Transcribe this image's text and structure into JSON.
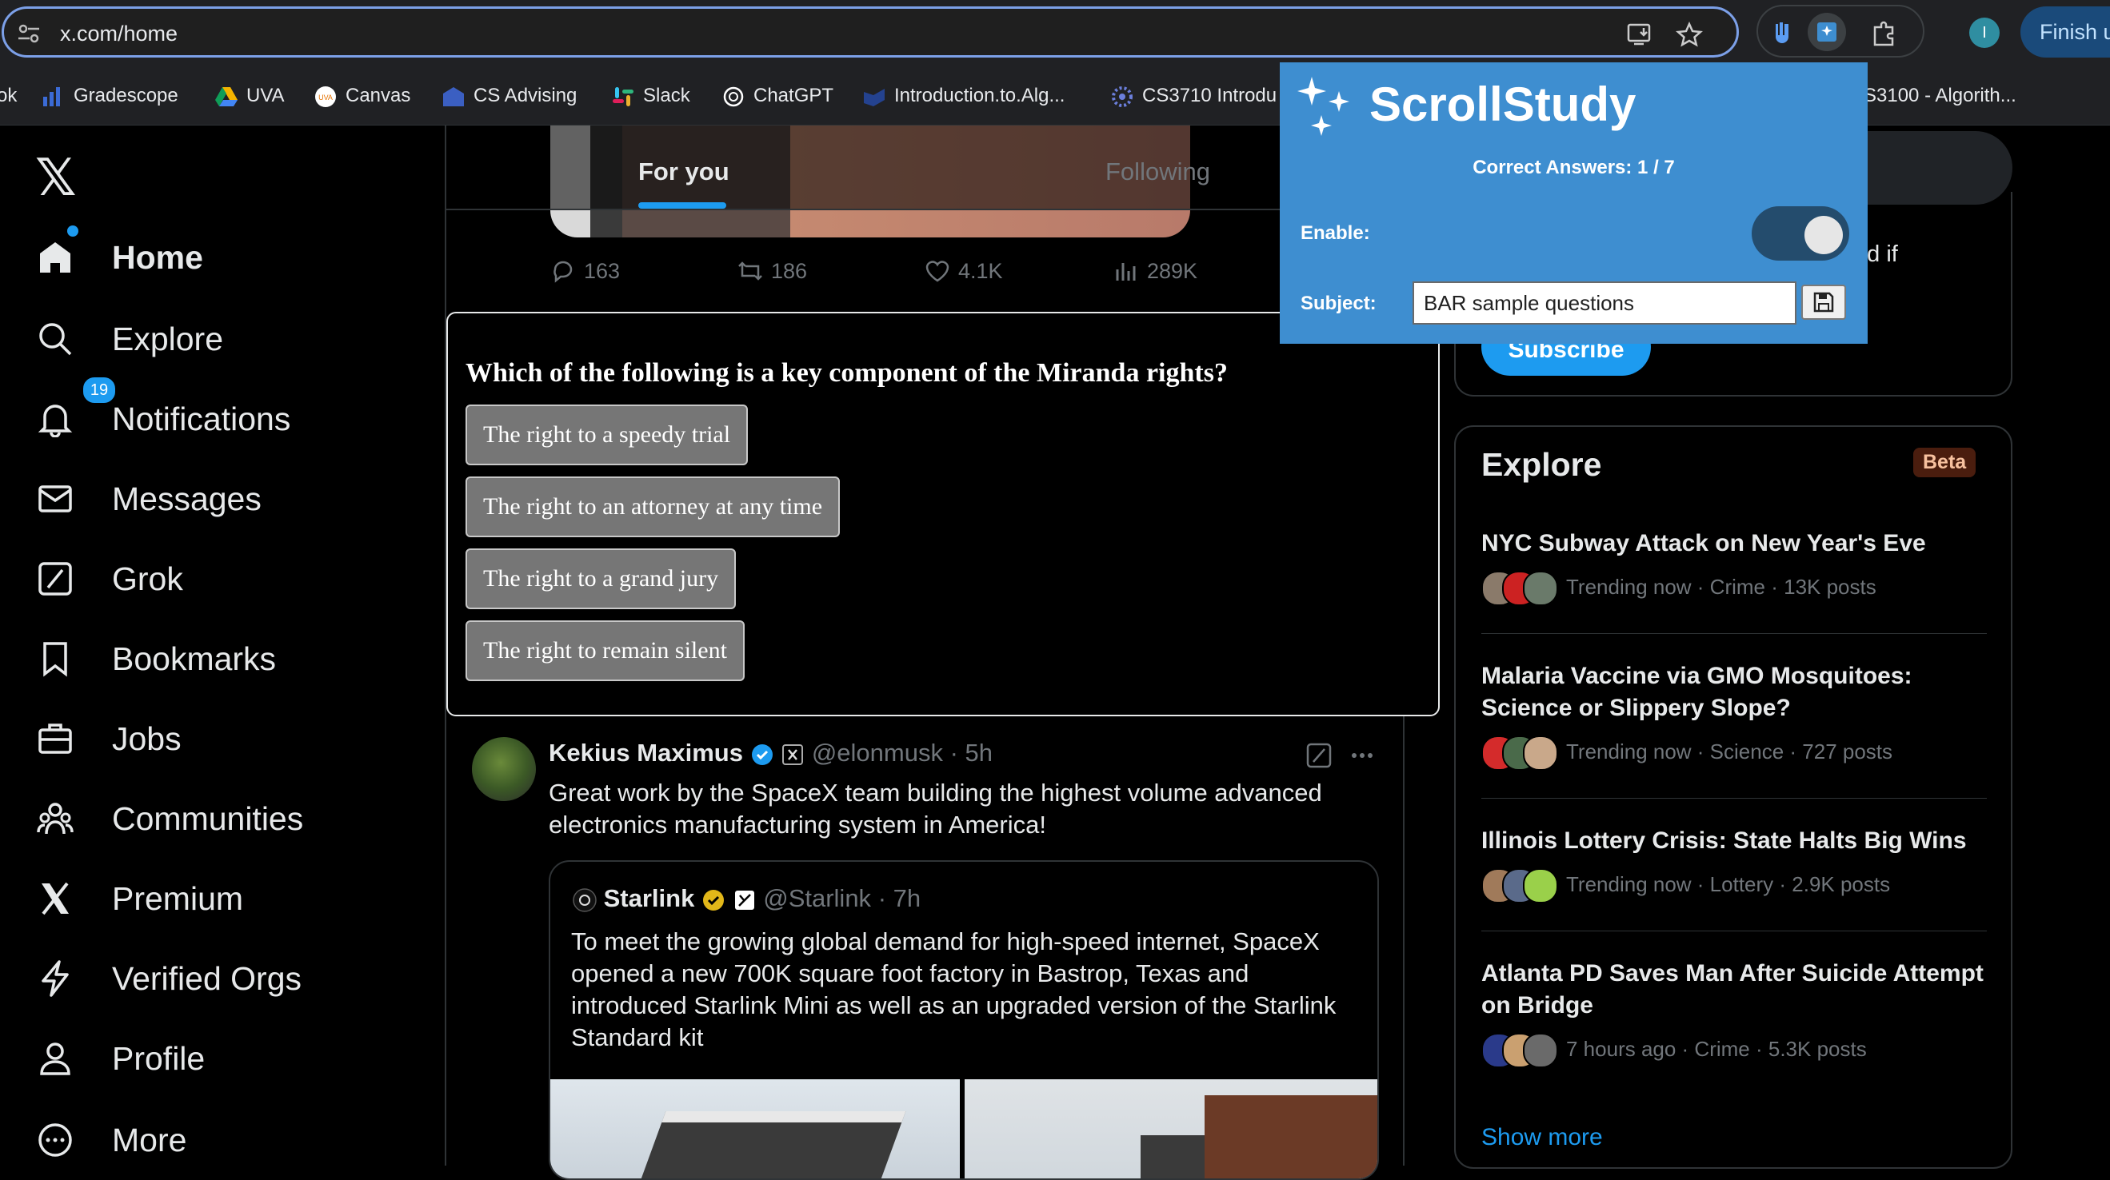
{
  "browser": {
    "url": "x.com/home",
    "profile_initial": "I",
    "finish_label": "Finish u"
  },
  "bookmarks": [
    {
      "label": "ok"
    },
    {
      "label": "Gradescope"
    },
    {
      "label": "UVA"
    },
    {
      "label": "Canvas"
    },
    {
      "label": "CS Advising"
    },
    {
      "label": "Slack"
    },
    {
      "label": "ChatGPT"
    },
    {
      "label": "Introduction.to.Alg..."
    },
    {
      "label": "CS3710 Introdu"
    },
    {
      "label": "S3100 - Algorith..."
    }
  ],
  "nav": {
    "items": [
      {
        "label": "Home"
      },
      {
        "label": "Explore"
      },
      {
        "label": "Notifications",
        "badge": "19"
      },
      {
        "label": "Messages"
      },
      {
        "label": "Grok"
      },
      {
        "label": "Bookmarks"
      },
      {
        "label": "Jobs"
      },
      {
        "label": "Communities"
      },
      {
        "label": "Premium"
      },
      {
        "label": "Verified Orgs"
      },
      {
        "label": "Profile"
      },
      {
        "label": "More"
      }
    ]
  },
  "feed": {
    "tabs": [
      {
        "label": "For you"
      },
      {
        "label": "Following"
      }
    ],
    "prev_tweet_actions": {
      "replies": "163",
      "reposts": "186",
      "likes": "4.1K",
      "views": "289K"
    },
    "quiz": {
      "question": "Which of the following is a key component of the Miranda rights?",
      "options": [
        "The right to a speedy trial",
        "The right to an attorney at any time",
        "The right to a grand jury",
        "The right to remain silent"
      ]
    },
    "tweet": {
      "author": "Kekius Maximus",
      "handle": "@elonmusk",
      "time": "· 5h",
      "text": "Great work by the SpaceX team building the highest volume advanced electronics manufacturing system in America!",
      "quote": {
        "author": "Starlink",
        "handle": "@Starlink",
        "time": "· 7h",
        "text": "To meet the growing global demand for high-speed internet, SpaceX opened a new 700K square foot factory in Bastrop, Texas and introduced Starlink Mini as well as an upgraded version of the Starlink Standard kit"
      }
    }
  },
  "sidebar": {
    "subscribe_text": "nd if",
    "subscribe_label": "Subscribe",
    "explore": {
      "title": "Explore",
      "badge": "Beta",
      "trends": [
        {
          "title": "NYC Subway Attack on New Year's Eve",
          "meta": "Trending now · Crime · 13K posts"
        },
        {
          "title": "Malaria Vaccine via GMO Mosquitoes: Science or Slippery Slope?",
          "meta": "Trending now · Science · 727 posts"
        },
        {
          "title": "Illinois Lottery Crisis: State Halts Big Wins",
          "meta": "Trending now · Lottery · 2.9K posts"
        },
        {
          "title": "Atlanta PD Saves Man After Suicide Attempt on Bridge",
          "meta": "7 hours ago · Crime · 5.3K posts"
        }
      ],
      "show_more": "Show more"
    }
  },
  "popup": {
    "title": "ScrollStudy",
    "counter": "Correct Answers: 1 / 7",
    "enable_label": "Enable:",
    "enabled": true,
    "subject_label": "Subject:",
    "subject_value": "BAR sample questions"
  }
}
